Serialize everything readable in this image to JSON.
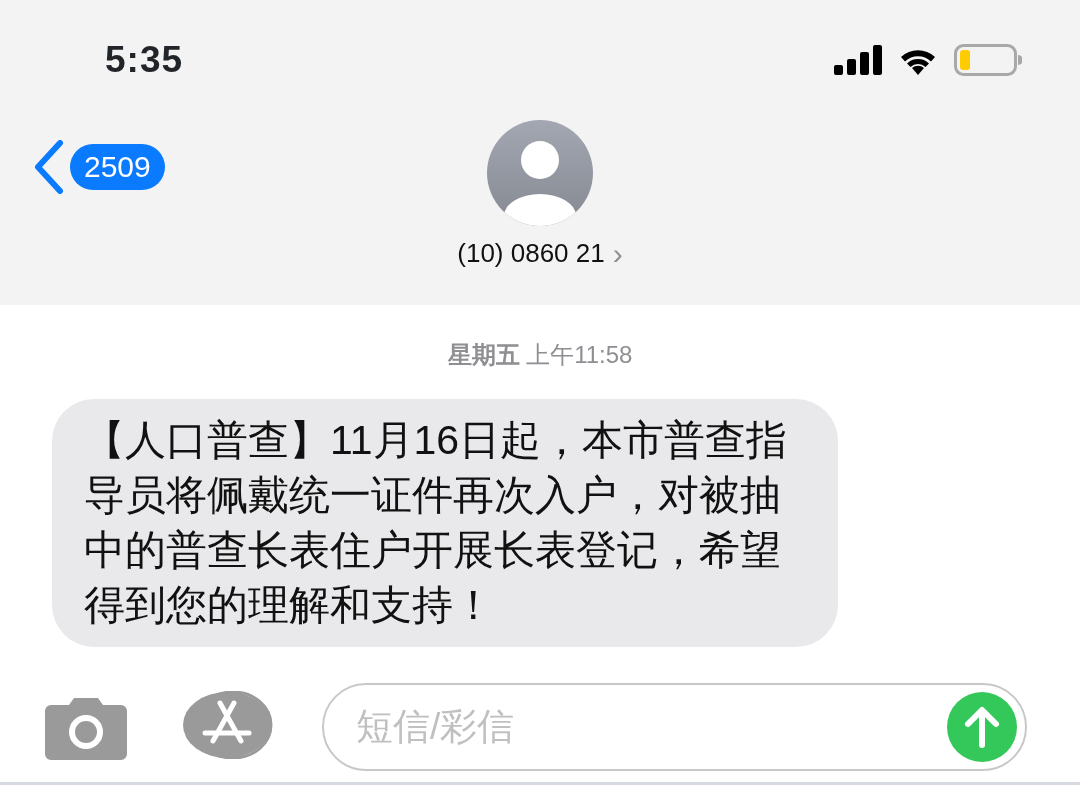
{
  "status_bar": {
    "time": "5:35"
  },
  "header": {
    "back_count": "2509",
    "contact": "(10) 0860 21",
    "chevron": "›"
  },
  "conversation": {
    "timestamp": "**星期五** 上午11:58",
    "messages": [
      {
        "kind": "received",
        "text": "【人口普查】11月16日起，本市普查指导员将佩戴统一证件再次入户，对被抽中的普查长表住户开展长表登记，希望得到您的理解和支持！"
      }
    ]
  },
  "composer": {
    "placeholder": "短信/彩信"
  }
}
